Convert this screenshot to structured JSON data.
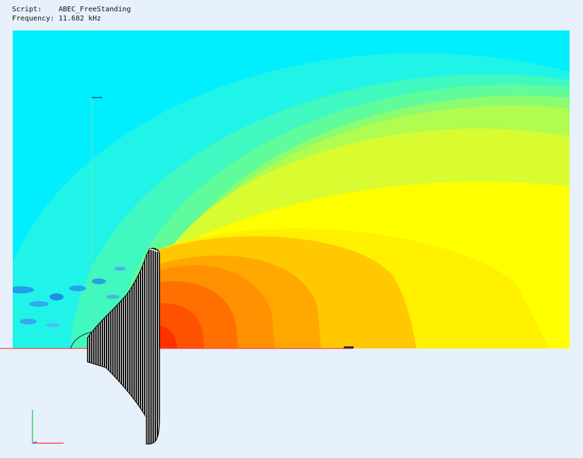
{
  "info": {
    "script_label": "Script:",
    "script_value": "ABEC_FreeStanding",
    "frequency_label": "Frequency:",
    "frequency_value": "11.682 kHz"
  },
  "colors": {
    "background": "#e6f1fc",
    "field_low": "#00f0ff",
    "field_mid": "#ffff00",
    "field_high": "#ff3000",
    "symmetry_axis": "#ff4040",
    "orientation_x": "#ff3030",
    "orientation_y": "#20c040",
    "horn_mesh": "#202020"
  },
  "icons": [
    "orientation-axes-icon",
    "horn-mesh-icon",
    "probe-marker-icon"
  ]
}
